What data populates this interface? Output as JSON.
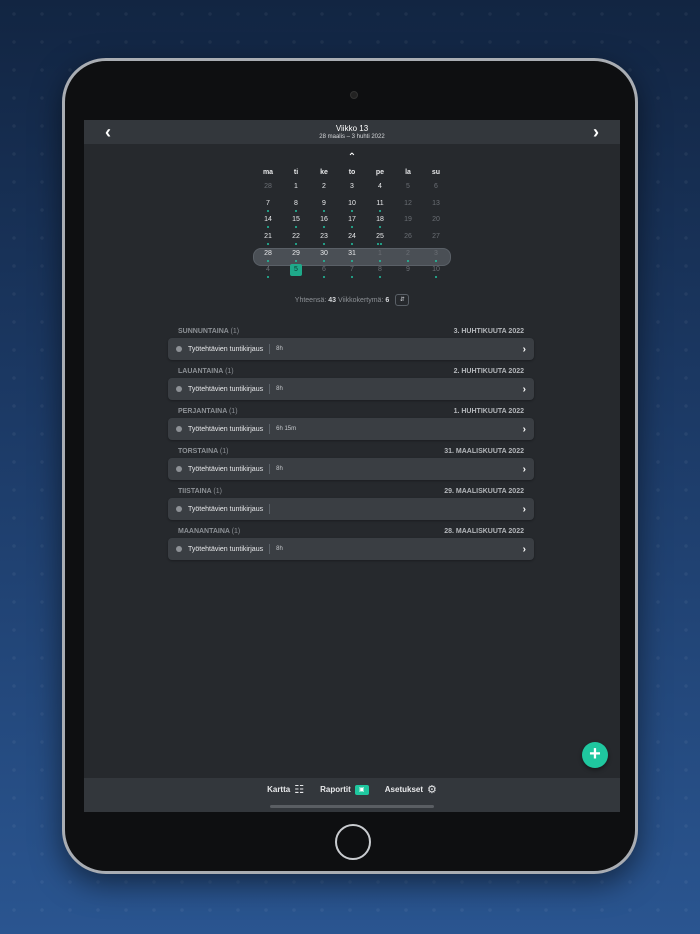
{
  "header": {
    "title": "Viikko 13",
    "range": "28 maalis – 3 huhti 2022",
    "prev_icon": "chevron-left-icon",
    "next_icon": "chevron-right-icon"
  },
  "calendar": {
    "weekdays": [
      "ma",
      "ti",
      "ke",
      "to",
      "pe",
      "la",
      "su"
    ],
    "weeks": [
      [
        "28",
        "1",
        "2",
        "3",
        "4",
        "5",
        "6"
      ],
      [
        "7",
        "8",
        "9",
        "10",
        "11",
        "12",
        "13"
      ],
      [
        "14",
        "15",
        "16",
        "17",
        "18",
        "19",
        "20"
      ],
      [
        "21",
        "22",
        "23",
        "24",
        "25",
        "26",
        "27"
      ],
      [
        "28",
        "29",
        "30",
        "31",
        "1",
        "2",
        "3"
      ],
      [
        "4",
        "5",
        "6",
        "7",
        "8",
        "9",
        "10"
      ]
    ]
  },
  "totals": {
    "label_total": "Yhteensä:",
    "total_value": "43",
    "label_week": "Viikkokertymä:",
    "week_value": "6"
  },
  "days": [
    {
      "weekday": "SUNNUNTAINA",
      "count": "(1)",
      "date": "3. HUHTIKUUTA 2022",
      "entry": "Työtehtävien tuntikirjaus",
      "duration": "8h"
    },
    {
      "weekday": "LAUANTAINA",
      "count": "(1)",
      "date": "2. HUHTIKUUTA 2022",
      "entry": "Työtehtävien tuntikirjaus",
      "duration": "8h"
    },
    {
      "weekday": "PERJANTAINA",
      "count": "(1)",
      "date": "1. HUHTIKUUTA 2022",
      "entry": "Työtehtävien tuntikirjaus",
      "duration": "6h 15m"
    },
    {
      "weekday": "TORSTAINA",
      "count": "(1)",
      "date": "31. MAALISKUUTA 2022",
      "entry": "Työtehtävien tuntikirjaus",
      "duration": "8h"
    },
    {
      "weekday": "TIISTAINA",
      "count": "(1)",
      "date": "29. MAALISKUUTA 2022",
      "entry": "Työtehtävien tuntikirjaus",
      "duration": ""
    },
    {
      "weekday": "MAANANTAINA",
      "count": "(1)",
      "date": "28. MAALISKUUTA 2022",
      "entry": "Työtehtävien tuntikirjaus",
      "duration": "8h"
    }
  ],
  "fab": {
    "label": "+"
  },
  "tabs": [
    {
      "label": "Kartta",
      "icon": "map-icon"
    },
    {
      "label": "Raportit",
      "icon": "report-card-icon"
    },
    {
      "label": "Asetukset",
      "icon": "gear-icon"
    }
  ],
  "colors": {
    "accent": "#1fc79f",
    "screen_bg": "#26292d",
    "bar_bg": "#33373c"
  }
}
